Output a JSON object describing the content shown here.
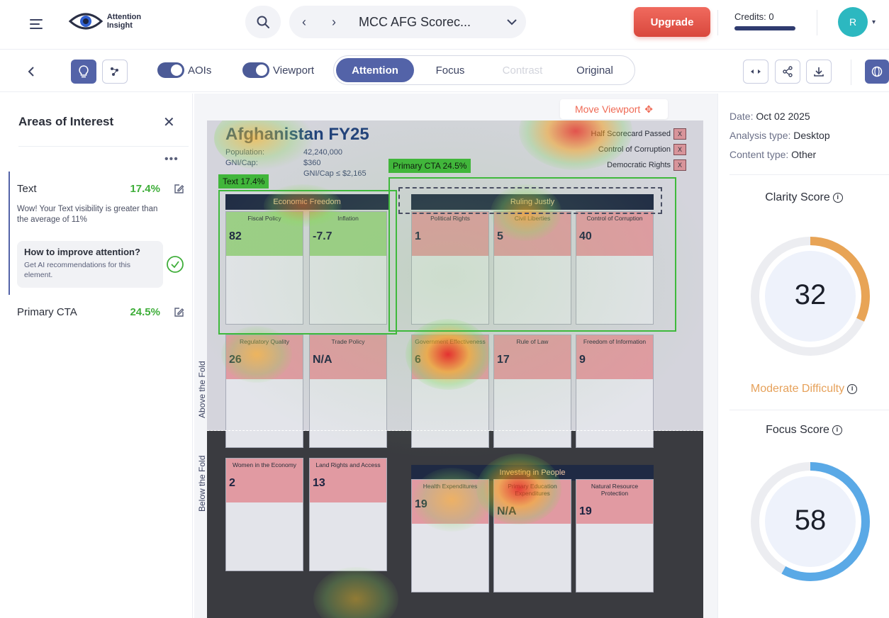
{
  "app": {
    "logo_line1": "Attention",
    "logo_line2": "Insight"
  },
  "header": {
    "project_title": "MCC AFG Scorec...",
    "upgrade_label": "Upgrade",
    "credits_label": "Credits: 0",
    "avatar_initial": "R"
  },
  "toolbar": {
    "aois_label": "AOIs",
    "viewport_label": "Viewport",
    "modes": [
      {
        "label": "Attention",
        "state": "active"
      },
      {
        "label": "Focus",
        "state": "normal"
      },
      {
        "label": "Contrast",
        "state": "disabled"
      },
      {
        "label": "Original",
        "state": "normal"
      }
    ]
  },
  "aoi_panel": {
    "title": "Areas of Interest",
    "items": [
      {
        "name": "Text",
        "percent": "17.4%",
        "description": "Wow! Your Text visibility is greater than the average of 11%"
      },
      {
        "name": "Primary CTA",
        "percent": "24.5%"
      }
    ],
    "improve_title": "How to improve attention?",
    "improve_text": "Get AI recommendations for this element."
  },
  "canvas": {
    "move_viewport_label": "Move Viewport",
    "above_fold": "Above the Fold",
    "below_fold": "Below the Fold",
    "aoi_tags": {
      "text": "Text  17.4%",
      "cta": "Primary CTA  24.5%"
    },
    "doc": {
      "title": "Afghanistan FY25",
      "meta_left": [
        "Population:",
        "GNI/Cap:"
      ],
      "meta_right": [
        "42,240,000",
        "$360",
        "GNI/Cap ≤ $2,165"
      ],
      "checklist": [
        "Half Scorecard Passed",
        "Control of Corruption",
        "Democratic Rights"
      ],
      "sections": [
        "Economic Freedom",
        "Ruling Justly",
        "Investing in People"
      ],
      "cards_top": [
        {
          "title": "Fiscal Policy",
          "value": "82",
          "color": "g"
        },
        {
          "title": "Inflation",
          "value": "-7.7",
          "color": "g"
        },
        {
          "title": "Political Rights",
          "value": "1",
          "color": "r"
        },
        {
          "title": "Civil Liberties",
          "value": "5",
          "color": "r"
        },
        {
          "title": "Control of Corruption",
          "value": "40",
          "color": "r"
        }
      ],
      "cards_mid": [
        {
          "title": "Regulatory Quality",
          "value": "26",
          "color": "r"
        },
        {
          "title": "Trade Policy",
          "value": "N/A",
          "color": "r"
        },
        {
          "title": "Government Effectiveness",
          "value": "6",
          "color": "r"
        },
        {
          "title": "Rule of Law",
          "value": "17",
          "color": "r"
        },
        {
          "title": "Freedom of Information",
          "value": "9",
          "color": "r"
        }
      ],
      "cards_low": [
        {
          "title": "Women in the Economy",
          "value": "2",
          "color": "r"
        },
        {
          "title": "Land Rights and Access",
          "value": "13",
          "color": "r"
        },
        {
          "title": "Health Expenditures",
          "value": "19",
          "color": "r"
        },
        {
          "title": "Primary Education Expenditures",
          "value": "N/A",
          "color": "r"
        },
        {
          "title": "Natural Resource Protection",
          "value": "19",
          "color": "r"
        }
      ]
    }
  },
  "analysis": {
    "date_label": "Date:",
    "date_value": "Oct 02 2025",
    "type_label": "Analysis type:",
    "type_value": "Desktop",
    "content_label": "Content type:",
    "content_value": "Other",
    "clarity_title": "Clarity Score",
    "clarity_value": 32,
    "difficulty": "Moderate Difficulty",
    "focus_title": "Focus Score",
    "focus_value": 58,
    "clarity_color": "#e8a456",
    "focus_color": "#5aa9e6"
  }
}
